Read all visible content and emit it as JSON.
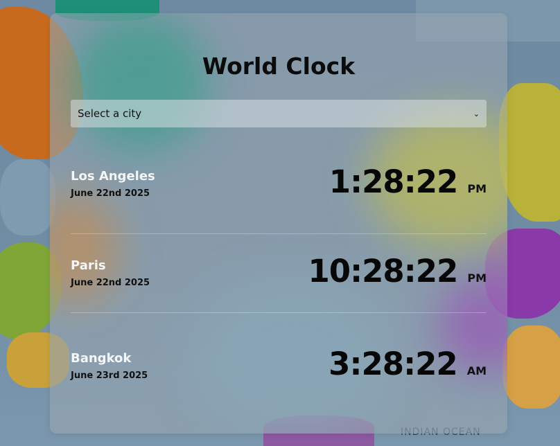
{
  "app": {
    "title": "World Clock"
  },
  "selector": {
    "label": "Select a city"
  },
  "background": {
    "ocean_label": "INDIAN OCEAN"
  },
  "cities": [
    {
      "name": "Los Angeles",
      "date": "June 22nd 2025",
      "time": "1:28:22",
      "ampm": "PM"
    },
    {
      "name": "Paris",
      "date": "June 22nd 2025",
      "time": "10:28:22",
      "ampm": "PM"
    },
    {
      "name": "Bangkok",
      "date": "June 23rd 2025",
      "time": "3:28:22",
      "ampm": "AM"
    }
  ],
  "colors": {
    "panel": "#96a5b0",
    "title": "#0b0b0b",
    "city_name": "#f4f6f8"
  },
  "icons": {
    "dropdown": "chevron-down-icon"
  }
}
